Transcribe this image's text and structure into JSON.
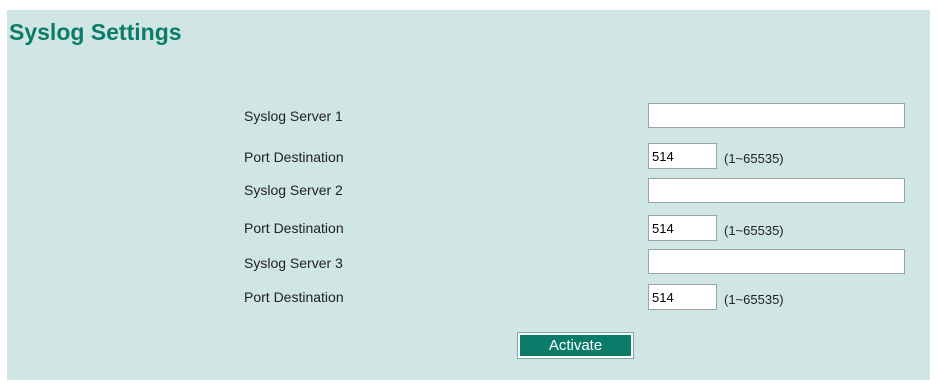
{
  "title": "Syslog Settings",
  "servers": [
    {
      "server_label": "Syslog Server 1",
      "server_value": "",
      "port_label": "Port Destination",
      "port_value": "514",
      "port_range": "(1~65535)"
    },
    {
      "server_label": "Syslog Server 2",
      "server_value": "",
      "port_label": "Port Destination",
      "port_value": "514",
      "port_range": "(1~65535)"
    },
    {
      "server_label": "Syslog Server 3",
      "server_value": "",
      "port_label": "Port Destination",
      "port_value": "514",
      "port_range": "(1~65535)"
    }
  ],
  "activate_label": "Activate",
  "colors": {
    "panel_background": "#cfe6e4",
    "accent": "#0b7c6a"
  }
}
